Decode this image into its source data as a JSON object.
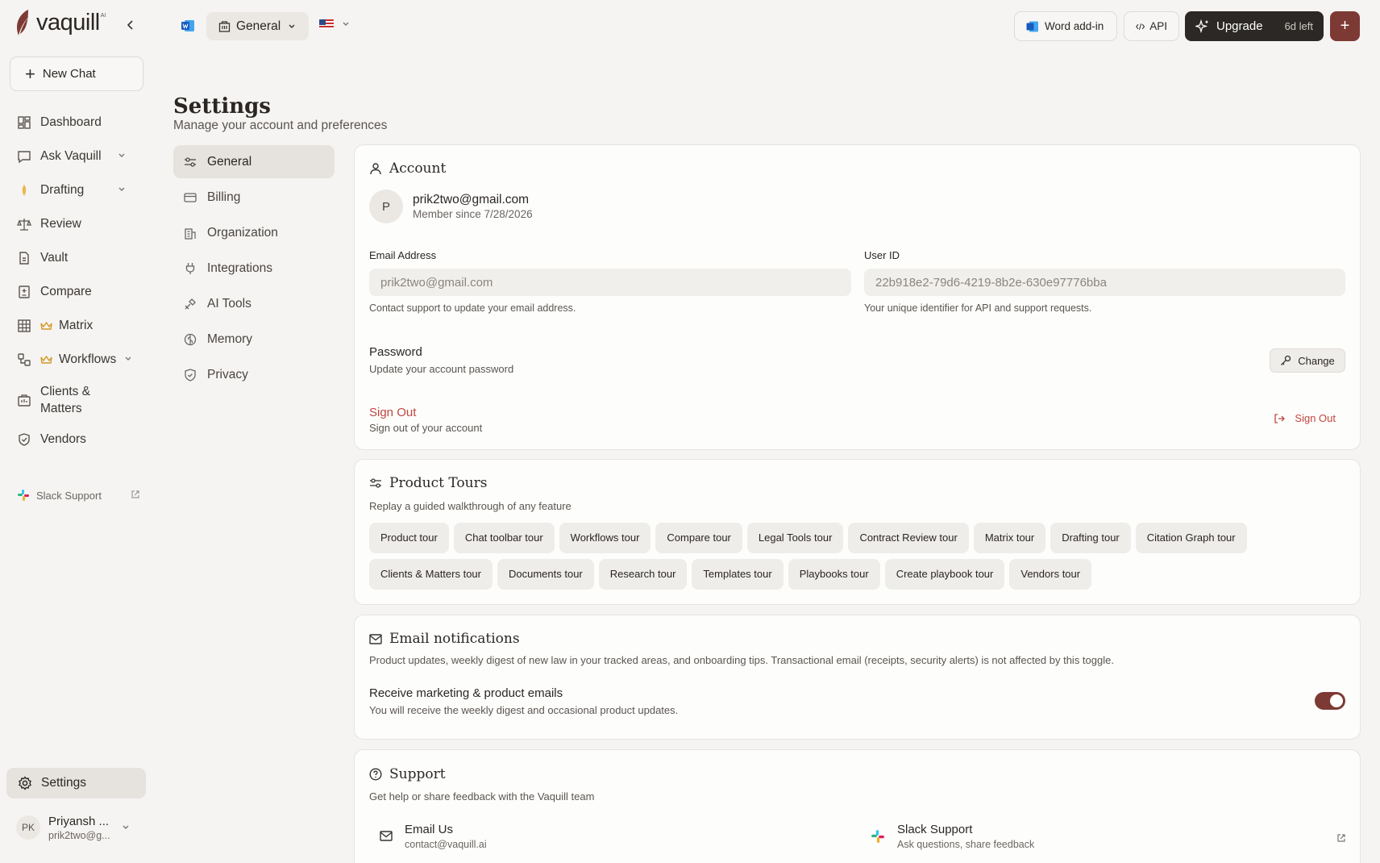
{
  "brand": {
    "name": "vaquill",
    "superscript": "AI"
  },
  "sidebar": {
    "new_chat": "New Chat",
    "items": [
      {
        "label": "Dashboard",
        "icon": "dashboard-icon"
      },
      {
        "label": "Ask Vaquill",
        "icon": "chat-icon",
        "expandable": true
      },
      {
        "label": "Drafting",
        "icon": "pen-nib-icon",
        "expandable": true
      },
      {
        "label": "Review",
        "icon": "scales-icon"
      },
      {
        "label": "Vault",
        "icon": "document-icon"
      },
      {
        "label": "Compare",
        "icon": "compare-icon"
      },
      {
        "label": "Matrix",
        "icon": "grid-icon",
        "premium": true
      },
      {
        "label": "Workflows",
        "icon": "workflow-icon",
        "premium": true,
        "expandable": true
      },
      {
        "label": "Clients & Matters",
        "icon": "briefcase-icon"
      },
      {
        "label": "Vendors",
        "icon": "shield-icon"
      }
    ],
    "slack_support": "Slack Support",
    "settings": "Settings",
    "user": {
      "initials": "PK",
      "name": "Priyansh ...",
      "email": "prik2two@g..."
    }
  },
  "topbar": {
    "workspace": "General",
    "word_addin": "Word add-in",
    "api": "API",
    "upgrade": "Upgrade",
    "days_left": "6d left",
    "plus": "+"
  },
  "page": {
    "title": "Settings",
    "subtitle": "Manage your account and preferences"
  },
  "settings_nav": [
    {
      "label": "General",
      "icon": "sliders-icon",
      "active": true
    },
    {
      "label": "Billing",
      "icon": "credit-card-icon"
    },
    {
      "label": "Organization",
      "icon": "building-icon"
    },
    {
      "label": "Integrations",
      "icon": "plug-icon"
    },
    {
      "label": "AI Tools",
      "icon": "tools-icon"
    },
    {
      "label": "Memory",
      "icon": "brain-icon"
    },
    {
      "label": "Privacy",
      "icon": "shield-check-icon"
    }
  ],
  "account": {
    "title": "Account",
    "avatar_initial": "P",
    "email": "prik2two@gmail.com",
    "member_since": "Member since 7/28/2026",
    "email_label": "Email Address",
    "email_value": "prik2two@gmail.com",
    "email_help": "Contact support to update your email address.",
    "userid_label": "User ID",
    "userid_value": "22b918e2-79d6-4219-8b2e-630e97776bba",
    "userid_help": "Your unique identifier for API and support requests.",
    "password_title": "Password",
    "password_sub": "Update your account password",
    "change_label": "Change",
    "signout_title": "Sign Out",
    "signout_sub": "Sign out of your account",
    "signout_button": "Sign Out"
  },
  "tours": {
    "title": "Product Tours",
    "subtitle": "Replay a guided walkthrough of any feature",
    "items": [
      "Product tour",
      "Chat toolbar tour",
      "Workflows tour",
      "Compare tour",
      "Legal Tools tour",
      "Contract Review tour",
      "Matrix tour",
      "Drafting tour",
      "Citation Graph tour",
      "Clients & Matters tour",
      "Documents tour",
      "Research tour",
      "Templates tour",
      "Playbooks tour",
      "Create playbook tour",
      "Vendors tour"
    ]
  },
  "email_notifications": {
    "title": "Email notifications",
    "description": "Product updates, weekly digest of new law in your tracked areas, and onboarding tips. Transactional email (receipts, security alerts) is not affected by this toggle.",
    "toggle_title": "Receive marketing & product emails",
    "toggle_sub": "You will receive the weekly digest and occasional product updates.",
    "enabled": true
  },
  "support": {
    "title": "Support",
    "subtitle": "Get help or share feedback with the Vaquill team",
    "email_title": "Email Us",
    "email_value": "contact@vaquill.ai",
    "slack_title": "Slack Support",
    "slack_sub": "Ask questions, share feedback"
  },
  "colors": {
    "accent": "#7d3a35",
    "danger": "#c0473f",
    "dark": "#2b2825"
  }
}
